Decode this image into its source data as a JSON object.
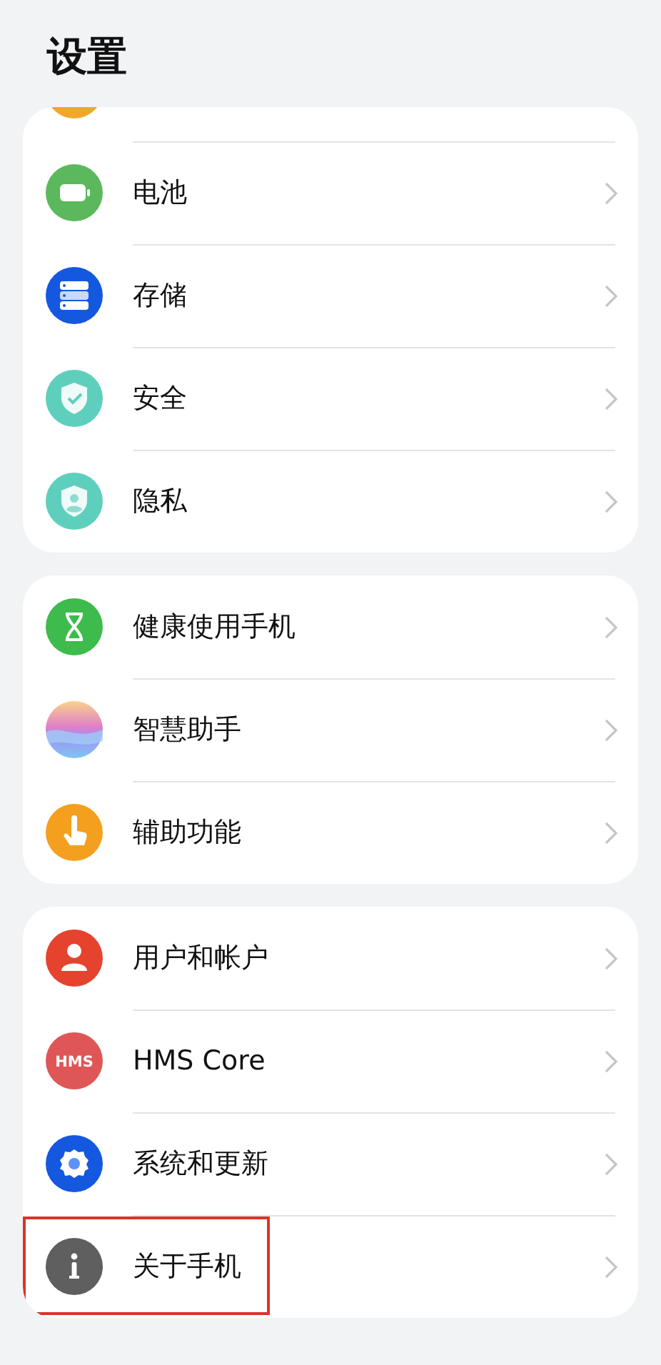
{
  "title": "设置",
  "cards": [
    {
      "clipped_top": true,
      "items": [
        {
          "label": "电池",
          "highlighted": false
        },
        {
          "label": "存储",
          "highlighted": false
        },
        {
          "label": "安全",
          "highlighted": false
        },
        {
          "label": "隐私",
          "highlighted": false
        }
      ]
    },
    {
      "clipped_top": false,
      "items": [
        {
          "label": "健康使用手机",
          "highlighted": false
        },
        {
          "label": "智慧助手",
          "highlighted": false
        },
        {
          "label": "辅助功能",
          "highlighted": false
        }
      ]
    },
    {
      "clipped_top": false,
      "items": [
        {
          "label": "用户和帐户",
          "highlighted": false
        },
        {
          "label": "HMS Core",
          "icon_text": "HMS",
          "highlighted": false
        },
        {
          "label": "系统和更新",
          "highlighted": false
        },
        {
          "label": "关于手机",
          "highlighted": true
        }
      ]
    }
  ]
}
